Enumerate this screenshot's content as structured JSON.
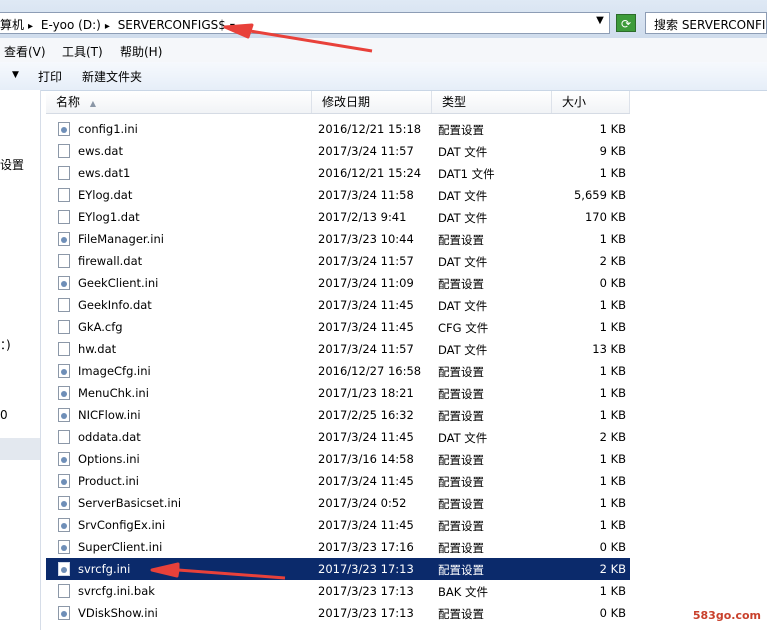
{
  "address": {
    "crumbs": [
      "算机",
      "E-yoo (D:)",
      "SERVERCONFIGS$"
    ],
    "dropdown_icon": "chevron-down-icon"
  },
  "search": {
    "placeholder": "搜索 SERVERCONFIGS$"
  },
  "menu": {
    "view": "查看(V)",
    "tools": "工具(T)",
    "help": "帮助(H)"
  },
  "toolbar": {
    "print": "打印",
    "new_folder": "新建文件夹"
  },
  "nav": {
    "fragments": [
      "设置",
      "：)",
      "0"
    ]
  },
  "columns": {
    "name": "名称",
    "date": "修改日期",
    "type": "类型",
    "size": "大小"
  },
  "files": [
    {
      "name": "config1.ini",
      "date": "2016/12/21 15:18",
      "type": "配置设置",
      "size": "1 KB",
      "icon": "ini"
    },
    {
      "name": "ews.dat",
      "date": "2017/3/24 11:57",
      "type": "DAT 文件",
      "size": "9 KB",
      "icon": "dat"
    },
    {
      "name": "ews.dat1",
      "date": "2016/12/21 15:24",
      "type": "DAT1 文件",
      "size": "1 KB",
      "icon": "dat"
    },
    {
      "name": "EYlog.dat",
      "date": "2017/3/24 11:58",
      "type": "DAT 文件",
      "size": "5,659 KB",
      "icon": "dat"
    },
    {
      "name": "EYlog1.dat",
      "date": "2017/2/13 9:41",
      "type": "DAT 文件",
      "size": "170 KB",
      "icon": "dat"
    },
    {
      "name": "FileManager.ini",
      "date": "2017/3/23 10:44",
      "type": "配置设置",
      "size": "1 KB",
      "icon": "ini"
    },
    {
      "name": "firewall.dat",
      "date": "2017/3/24 11:57",
      "type": "DAT 文件",
      "size": "2 KB",
      "icon": "dat"
    },
    {
      "name": "GeekClient.ini",
      "date": "2017/3/24 11:09",
      "type": "配置设置",
      "size": "0 KB",
      "icon": "ini"
    },
    {
      "name": "GeekInfo.dat",
      "date": "2017/3/24 11:45",
      "type": "DAT 文件",
      "size": "1 KB",
      "icon": "dat"
    },
    {
      "name": "GkA.cfg",
      "date": "2017/3/24 11:45",
      "type": "CFG 文件",
      "size": "1 KB",
      "icon": "dat"
    },
    {
      "name": "hw.dat",
      "date": "2017/3/24 11:57",
      "type": "DAT 文件",
      "size": "13 KB",
      "icon": "dat"
    },
    {
      "name": "ImageCfg.ini",
      "date": "2016/12/27 16:58",
      "type": "配置设置",
      "size": "1 KB",
      "icon": "ini"
    },
    {
      "name": "MenuChk.ini",
      "date": "2017/1/23 18:21",
      "type": "配置设置",
      "size": "1 KB",
      "icon": "ini"
    },
    {
      "name": "NICFlow.ini",
      "date": "2017/2/25 16:32",
      "type": "配置设置",
      "size": "1 KB",
      "icon": "ini"
    },
    {
      "name": "oddata.dat",
      "date": "2017/3/24 11:45",
      "type": "DAT 文件",
      "size": "2 KB",
      "icon": "dat"
    },
    {
      "name": "Options.ini",
      "date": "2017/3/16 14:58",
      "type": "配置设置",
      "size": "1 KB",
      "icon": "ini"
    },
    {
      "name": "Product.ini",
      "date": "2017/3/24 11:45",
      "type": "配置设置",
      "size": "1 KB",
      "icon": "ini"
    },
    {
      "name": "ServerBasicset.ini",
      "date": "2017/3/24 0:52",
      "type": "配置设置",
      "size": "1 KB",
      "icon": "ini"
    },
    {
      "name": "SrvConfigEx.ini",
      "date": "2017/3/24 11:45",
      "type": "配置设置",
      "size": "1 KB",
      "icon": "ini"
    },
    {
      "name": "SuperClient.ini",
      "date": "2017/3/23 17:16",
      "type": "配置设置",
      "size": "0 KB",
      "icon": "ini"
    },
    {
      "name": "svrcfg.ini",
      "date": "2017/3/23 17:13",
      "type": "配置设置",
      "size": "2 KB",
      "icon": "ini",
      "selected": true
    },
    {
      "name": "svrcfg.ini.bak",
      "date": "2017/3/23 17:13",
      "type": "BAK 文件",
      "size": "1 KB",
      "icon": "dat"
    },
    {
      "name": "VDiskShow.ini",
      "date": "2017/3/23 17:13",
      "type": "配置设置",
      "size": "0 KB",
      "icon": "ini"
    }
  ],
  "colors": {
    "selection": "#0b2a6b",
    "arrow": "#e8413a",
    "refresh": "#3d9b3a"
  },
  "watermark": "583go.com"
}
